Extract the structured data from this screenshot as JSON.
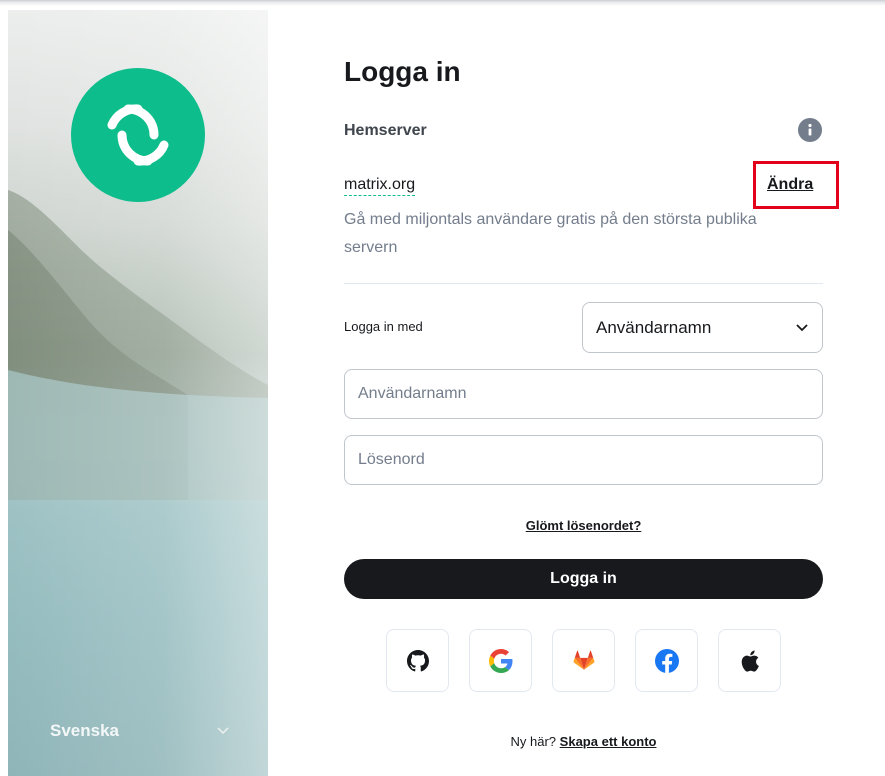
{
  "auth": {
    "title": "Logga in",
    "homeserver": {
      "label": "Hemserver",
      "info_icon": "info-icon",
      "name": "matrix.org",
      "change_label": "Ändra",
      "description": "Gå med miljontals användare gratis på den största publika servern"
    },
    "login_with": {
      "label": "Logga in med",
      "selected": "Användarnamn"
    },
    "username_placeholder": "Användarnamn",
    "password_placeholder": "Lösenord",
    "forgot_password": "Glömt lösenordet?",
    "login_button": "Logga in",
    "sso_providers": [
      {
        "name": "GitHub",
        "icon": "github-icon"
      },
      {
        "name": "Google",
        "icon": "google-icon"
      },
      {
        "name": "GitLab",
        "icon": "gitlab-icon"
      },
      {
        "name": "Facebook",
        "icon": "facebook-icon"
      },
      {
        "name": "Apple",
        "icon": "apple-icon"
      }
    ],
    "register": {
      "prompt": "Ny här?",
      "link": "Skapa ett konto"
    }
  },
  "sidebar": {
    "logo_icon": "element-logo-icon",
    "language": "Svenska"
  },
  "colors": {
    "brand": "#0dbd8b",
    "primary_button": "#17191c",
    "highlight_box": "#e2001a",
    "muted_text": "#737d8c"
  }
}
